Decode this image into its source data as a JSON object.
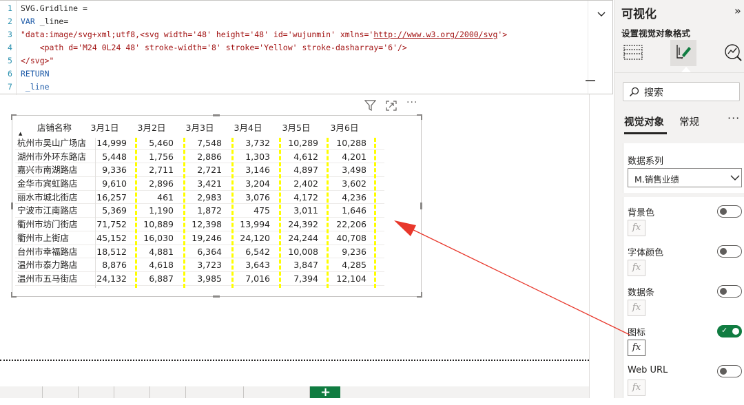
{
  "editor": {
    "lines": [
      {
        "num": "1",
        "parts": [
          {
            "t": "SVG.Gridline =",
            "c": ""
          }
        ]
      },
      {
        "num": "2",
        "parts": [
          {
            "t": "VAR",
            "c": "kw"
          },
          {
            "t": " _line=",
            "c": ""
          }
        ]
      },
      {
        "num": "3",
        "parts": [
          {
            "t": "\"data:image/svg+xml;utf8,<svg width='48' height='48' id='wujunmin' xmlns='",
            "c": "str"
          },
          {
            "t": "http://www.w3.org/2000/svg",
            "c": "str-u"
          },
          {
            "t": "'>",
            "c": "str"
          }
        ]
      },
      {
        "num": "4",
        "parts": [
          {
            "t": "    <path d='M24 0L24 48' stroke-width='8' stroke='Yellow' stroke-dasharray='6'/>",
            "c": "str"
          }
        ]
      },
      {
        "num": "5",
        "parts": [
          {
            "t": "</svg>\"",
            "c": "str"
          }
        ]
      },
      {
        "num": "6",
        "parts": [
          {
            "t": "RETURN",
            "c": "kw"
          }
        ]
      },
      {
        "num": "7",
        "parts": [
          {
            "t": " _line",
            "c": "kw"
          }
        ]
      }
    ]
  },
  "table": {
    "headers": [
      "店铺名称",
      "3月1日",
      "3月2日",
      "3月3日",
      "3月4日",
      "3月5日",
      "3月6日"
    ],
    "rows": [
      [
        "杭州市吴山广场店",
        "14,999",
        "5,460",
        "7,548",
        "3,732",
        "10,289",
        "10,288"
      ],
      [
        "湖州市外环东路店",
        "5,448",
        "1,756",
        "2,886",
        "1,303",
        "4,612",
        "4,201"
      ],
      [
        "嘉兴市南湖路店",
        "9,336",
        "2,711",
        "2,721",
        "3,146",
        "4,897",
        "3,498"
      ],
      [
        "金华市宾虹路店",
        "9,610",
        "2,896",
        "3,421",
        "3,204",
        "2,402",
        "3,602"
      ],
      [
        "丽水市城北街店",
        "16,257",
        "461",
        "2,983",
        "3,076",
        "4,172",
        "4,236"
      ],
      [
        "宁波市江南路店",
        "5,369",
        "1,190",
        "1,872",
        "475",
        "3,011",
        "1,646"
      ],
      [
        "衢州市坊门街店",
        "71,752",
        "10,889",
        "12,398",
        "13,994",
        "24,392",
        "22,206"
      ],
      [
        "衢州市上街店",
        "45,152",
        "16,030",
        "19,246",
        "24,120",
        "24,244",
        "40,708"
      ],
      [
        "台州市幸福路店",
        "18,512",
        "4,881",
        "6,364",
        "6,542",
        "10,008",
        "9,236"
      ],
      [
        "温州市泰力路店",
        "8,876",
        "4,618",
        "3,723",
        "3,643",
        "3,847",
        "4,285"
      ],
      [
        "温州市五马街店",
        "24,132",
        "6,887",
        "3,985",
        "7,016",
        "7,394",
        "12,104"
      ]
    ],
    "gridline_color": "#ffff00"
  },
  "pane": {
    "title": "可视化",
    "collapse_glyph": "»",
    "subtitle": "设置视觉对象格式",
    "search_placeholder": "搜索",
    "tabs": [
      "视觉对象",
      "常规"
    ],
    "more": "···",
    "series_label": "数据系列",
    "series_value": "M.销售业绩",
    "options": [
      {
        "label": "背景色",
        "on": false
      },
      {
        "label": "字体颜色",
        "on": false
      },
      {
        "label": "数据条",
        "on": false
      },
      {
        "label": "图标",
        "on": true
      },
      {
        "label": "Web URL",
        "on": false
      }
    ],
    "fx_label": "fx"
  },
  "colors": {
    "accent_green": "#107c41",
    "arrow_red": "#e8372b",
    "keyword_blue": "#1e5ba8",
    "string_red": "#a31515"
  },
  "bottom": {
    "page_tabs": [
      "",
      "",
      "",
      "",
      "",
      "",
      "",
      ""
    ]
  }
}
